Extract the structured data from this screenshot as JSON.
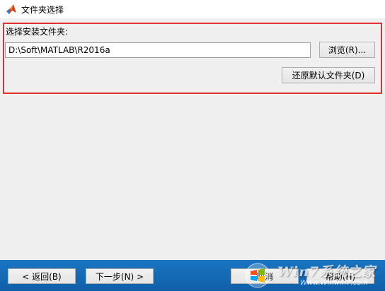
{
  "window": {
    "title": "文件夹选择",
    "icon": "matlab-icon"
  },
  "folder_section": {
    "label": "选择安装文件夹:",
    "path_value": "D:\\Soft\\MATLAB\\R2016a",
    "browse_label": "浏览(R)...",
    "restore_label": "还原默认文件夹(D)",
    "highlight_color": "#e0302a"
  },
  "footer": {
    "back_label": "< 返回(B)",
    "next_label": "下一步(N) >",
    "cancel_label": "取消",
    "help_label": "帮助(H)",
    "background_color": "#1b75c2"
  },
  "watermark": {
    "text": "Win7系统之家",
    "subtext": "Www.Winwin7.com",
    "icon": "windows-logo-icon"
  }
}
